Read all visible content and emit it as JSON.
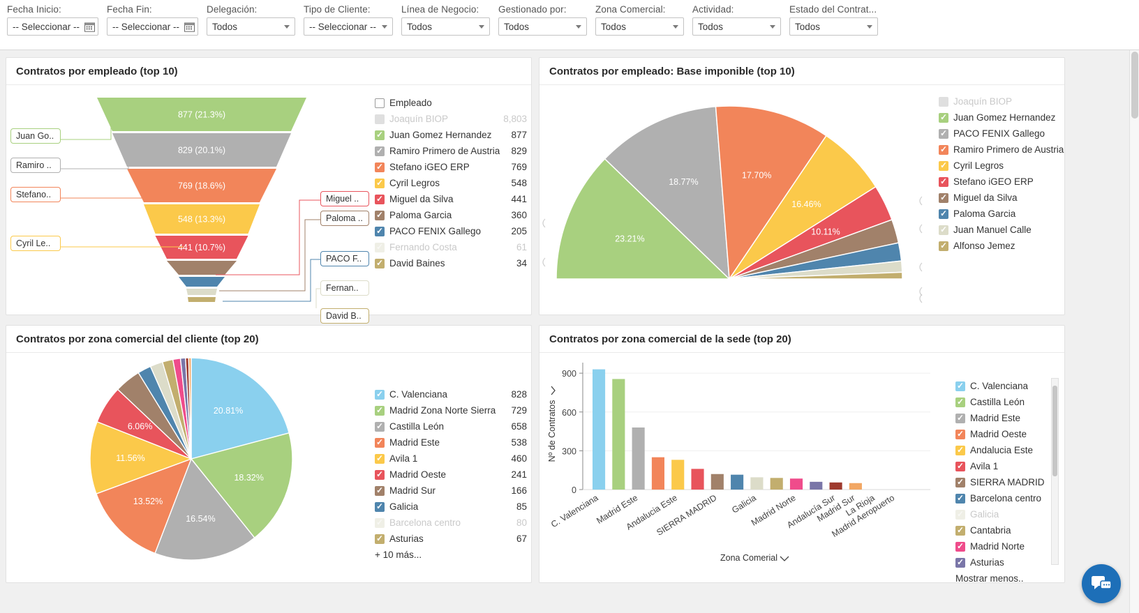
{
  "filters": [
    {
      "label": "Fecha Inicio:",
      "value": "-- Seleccionar --",
      "type": "date"
    },
    {
      "label": "Fecha Fin:",
      "value": "-- Seleccionar --",
      "type": "date"
    },
    {
      "label": "Delegación:",
      "value": "Todos",
      "type": "select"
    },
    {
      "label": "Tipo de Cliente:",
      "value": "-- Seleccionar --",
      "type": "select-sm"
    },
    {
      "label": "Línea de Negocio:",
      "value": "Todos",
      "type": "select"
    },
    {
      "label": "Gestionado por:",
      "value": "Todos",
      "type": "select"
    },
    {
      "label": "Zona Comercial:",
      "value": "Todos",
      "type": "select"
    },
    {
      "label": "Actividad:",
      "value": "Todos",
      "type": "select"
    },
    {
      "label": "Estado del Contrat...",
      "value": "Todos",
      "type": "select"
    }
  ],
  "panels": {
    "funnel": {
      "title": "Contratos por empleado (top 10)"
    },
    "semicircle": {
      "title": "Contratos por empleado: Base imponible (top 10)"
    },
    "pie": {
      "title": "Contratos por zona comercial del cliente (top 20)"
    },
    "bar": {
      "title": "Contratos por zona comercial de la sede (top 20)"
    }
  },
  "chart_data": [
    {
      "type": "bar",
      "chart_id": "funnel-contratos-por-empleado",
      "title": "Contratos por empleado (top 10)",
      "legend_header": "Empleado",
      "legend_position": "right",
      "categories": [
        "Joaquín BIOP",
        "Juan Gomez Hernandez",
        "Ramiro Primero de Austria",
        "Stefano iGEO ERP",
        "Cyril Legros",
        "Miguel da Silva",
        "Paloma Garcia",
        "PACO FENIX Gallego",
        "Fernando Costa",
        "David Baines"
      ],
      "values": [
        8803,
        877,
        829,
        769,
        548,
        441,
        360,
        205,
        61,
        34
      ],
      "value_labels": [
        "8,803",
        "877",
        "829",
        "769",
        "548",
        "441",
        "360",
        "205",
        "61",
        "34"
      ],
      "percent_labels": [
        "",
        "21.3%",
        "20.1%",
        "18.6%",
        "13.3%",
        "10.7%",
        "",
        "",
        "",
        ""
      ],
      "segment_labels": [
        "877 (21.3%)",
        "829 (20.1%)",
        "769 (18.6%)",
        "548 (13.3%)",
        "441 (10.7%)"
      ],
      "colors": [
        "#b8b8b8",
        "#a8d07f",
        "#b0b0b0",
        "#f2855a",
        "#fbc94a",
        "#e8545c",
        "#a1816a",
        "#4f85ad",
        "#dcdcc9",
        "#c2ae6e"
      ],
      "disabled": [
        "Joaquín BIOP",
        "Fernando Costa"
      ],
      "callouts_left": [
        "Juan Go..",
        "Ramiro ..",
        "Stefano..",
        "Cyril Le.."
      ],
      "callouts_right": [
        "Miguel ..",
        "Paloma ..",
        "PACO F..",
        "Fernan..",
        "David B.."
      ]
    },
    {
      "type": "pie",
      "chart_id": "semicircle-base-imponible",
      "title": "Contratos por empleado: Base imponible (top 10)",
      "legend_position": "right",
      "shape": "half-circle",
      "labels": [
        "Joaquín BIOP",
        "Juan Gomez Hernandez",
        "PACO FENIX Gallego",
        "Ramiro Primero de Austria",
        "Cyril Legros",
        "Stefano iGEO ERP",
        "Miguel da Silva",
        "Paloma Garcia",
        "Juan Manuel Calle",
        "Alfonso Jemez"
      ],
      "slice_percent_labels": [
        "23.21%",
        "18.77%",
        "17.70%",
        "16.46%",
        "10.11%"
      ],
      "values": [
        23.21,
        18.77,
        17.7,
        16.46,
        10.11,
        5.2,
        3.4,
        2.6,
        1.6,
        0.95
      ],
      "colors": [
        "#b8b8b8",
        "#a8d07f",
        "#b0b0b0",
        "#f2855a",
        "#fbc94a",
        "#e8545c",
        "#a1816a",
        "#4f85ad",
        "#dcdcc9",
        "#c2ae6e"
      ],
      "disabled": [
        "Joaquín BIOP"
      ]
    },
    {
      "type": "pie",
      "chart_id": "pie-zona-comercial-cliente",
      "title": "Contratos por zona comercial del cliente (top 20)",
      "legend_position": "right",
      "categories": [
        "C. Valenciana",
        "Madrid Zona Norte Sierra",
        "Castilla León",
        "Madrid Este",
        "Avila 1",
        "Madrid Oeste",
        "Madrid Sur",
        "Galicia",
        "Barcelona centro",
        "Asturias"
      ],
      "values": [
        828,
        729,
        658,
        538,
        460,
        241,
        166,
        85,
        80,
        67
      ],
      "slice_percent_labels": [
        "20.81%",
        "18.32%",
        "16.54%",
        "13.52%",
        "11.56%",
        "6.06%"
      ],
      "percentages": [
        20.81,
        18.32,
        16.54,
        13.52,
        11.56,
        6.06,
        4.17,
        2.14,
        2.01,
        1.68
      ],
      "colors": [
        "#8ad0ee",
        "#a8d07f",
        "#b0b0b0",
        "#f2855a",
        "#fbc94a",
        "#e8545c",
        "#a1816a",
        "#4f85ad",
        "#dcdcc9",
        "#c2ae6e",
        "#ef4c8b",
        "#7a76a8",
        "#9e3a2e",
        "#f2a763"
      ],
      "disabled": [
        "Barcelona centro"
      ],
      "more_label": "+ 10 más..."
    },
    {
      "type": "bar",
      "chart_id": "bar-zona-comercial-sede",
      "title": "Contratos por zona comercial de la sede (top 20)",
      "xlabel": "Zona Comerial",
      "ylabel": "Nº de Contratos",
      "ylim": [
        0,
        960
      ],
      "yticks": [
        0,
        300,
        600,
        900
      ],
      "grid": true,
      "legend_position": "right",
      "categories": [
        "C. Valenciana",
        "Castilla León",
        "Madrid Este",
        "Madrid Oeste",
        "Andalucia Este",
        "Avila 1",
        "SIERRA MADRID",
        "Barcelona centro",
        "Galicia",
        "Cantabria",
        "Madrid Norte",
        "Asturias",
        "Andalucía Sur",
        "Madrid Sur",
        "La Rioja",
        "Madrid Aeropuerto"
      ],
      "axis_tick_labels": [
        "C. Valenciana",
        "Madrid Este",
        "Andalucia Este",
        "SIERRA MADRID",
        "Galicia",
        "Madrid Norte",
        "Andalucía Sur",
        "Madrid Sur",
        "La Rioja",
        "Madrid Aeropuerto"
      ],
      "values": [
        930,
        855,
        480,
        250,
        230,
        160,
        120,
        115,
        95,
        90,
        85,
        60,
        55,
        50,
        0,
        0
      ],
      "colors": [
        "#8ad0ee",
        "#a8d07f",
        "#b0b0b0",
        "#f2855a",
        "#fbc94a",
        "#e8545c",
        "#a1816a",
        "#4f85ad",
        "#dcdcc9",
        "#c2ae6e",
        "#ef4c8b",
        "#7a76a8",
        "#9e3a2e",
        "#f2a763"
      ],
      "legend_labels": [
        "C. Valenciana",
        "Castilla León",
        "Madrid Este",
        "Madrid Oeste",
        "Andalucia Este",
        "Avila 1",
        "SIERRA MADRID",
        "Barcelona centro",
        "Galicia",
        "Cantabria",
        "Madrid Norte",
        "Asturias"
      ],
      "legend_colors": [
        "#8ad0ee",
        "#a8d07f",
        "#b0b0b0",
        "#f2855a",
        "#fbc94a",
        "#e8545c",
        "#a1816a",
        "#4f85ad",
        "#dcdcc9",
        "#c2ae6e",
        "#ef4c8b",
        "#7a76a8"
      ],
      "disabled": [
        "Galicia"
      ],
      "show_less_label": "Mostrar menos.."
    }
  ],
  "icons": {
    "calendar": "calendar-icon",
    "chevron_down": "chevron-down-icon",
    "chat": "chat-icon"
  },
  "accent_color": "#1d6fb8"
}
